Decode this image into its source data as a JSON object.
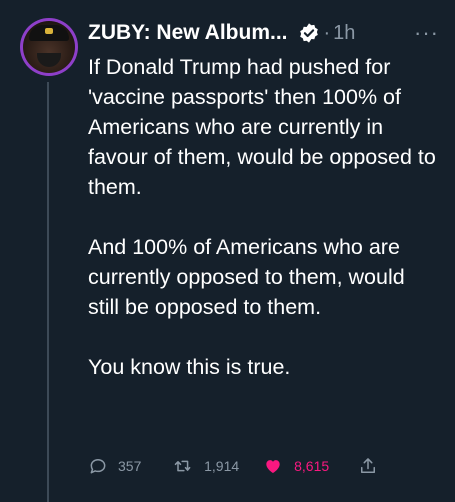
{
  "tweet": {
    "author_name": "ZUBY: New Album...",
    "verified": true,
    "separator": "·",
    "time": "1h",
    "more_label": "···",
    "paragraphs": [
      "If Donald Trump had pushed for 'vaccine passports' then 100% of Americans who are currently in favour of them, would be opposed to them.",
      "And 100% of Americans who are currently opposed to them, would still be opposed to them.",
      "You know this is true."
    ]
  },
  "actions": {
    "reply_count": "357",
    "retweet_count": "1,914",
    "like_count": "8,615",
    "liked": true,
    "icons": [
      "reply-icon",
      "retweet-icon",
      "heart-icon",
      "share-icon"
    ]
  },
  "colors": {
    "background": "#15202b",
    "text": "#ffffff",
    "secondary": "#8b98a5",
    "like": "#f91880",
    "avatar_ring": "#8e3fc9"
  }
}
